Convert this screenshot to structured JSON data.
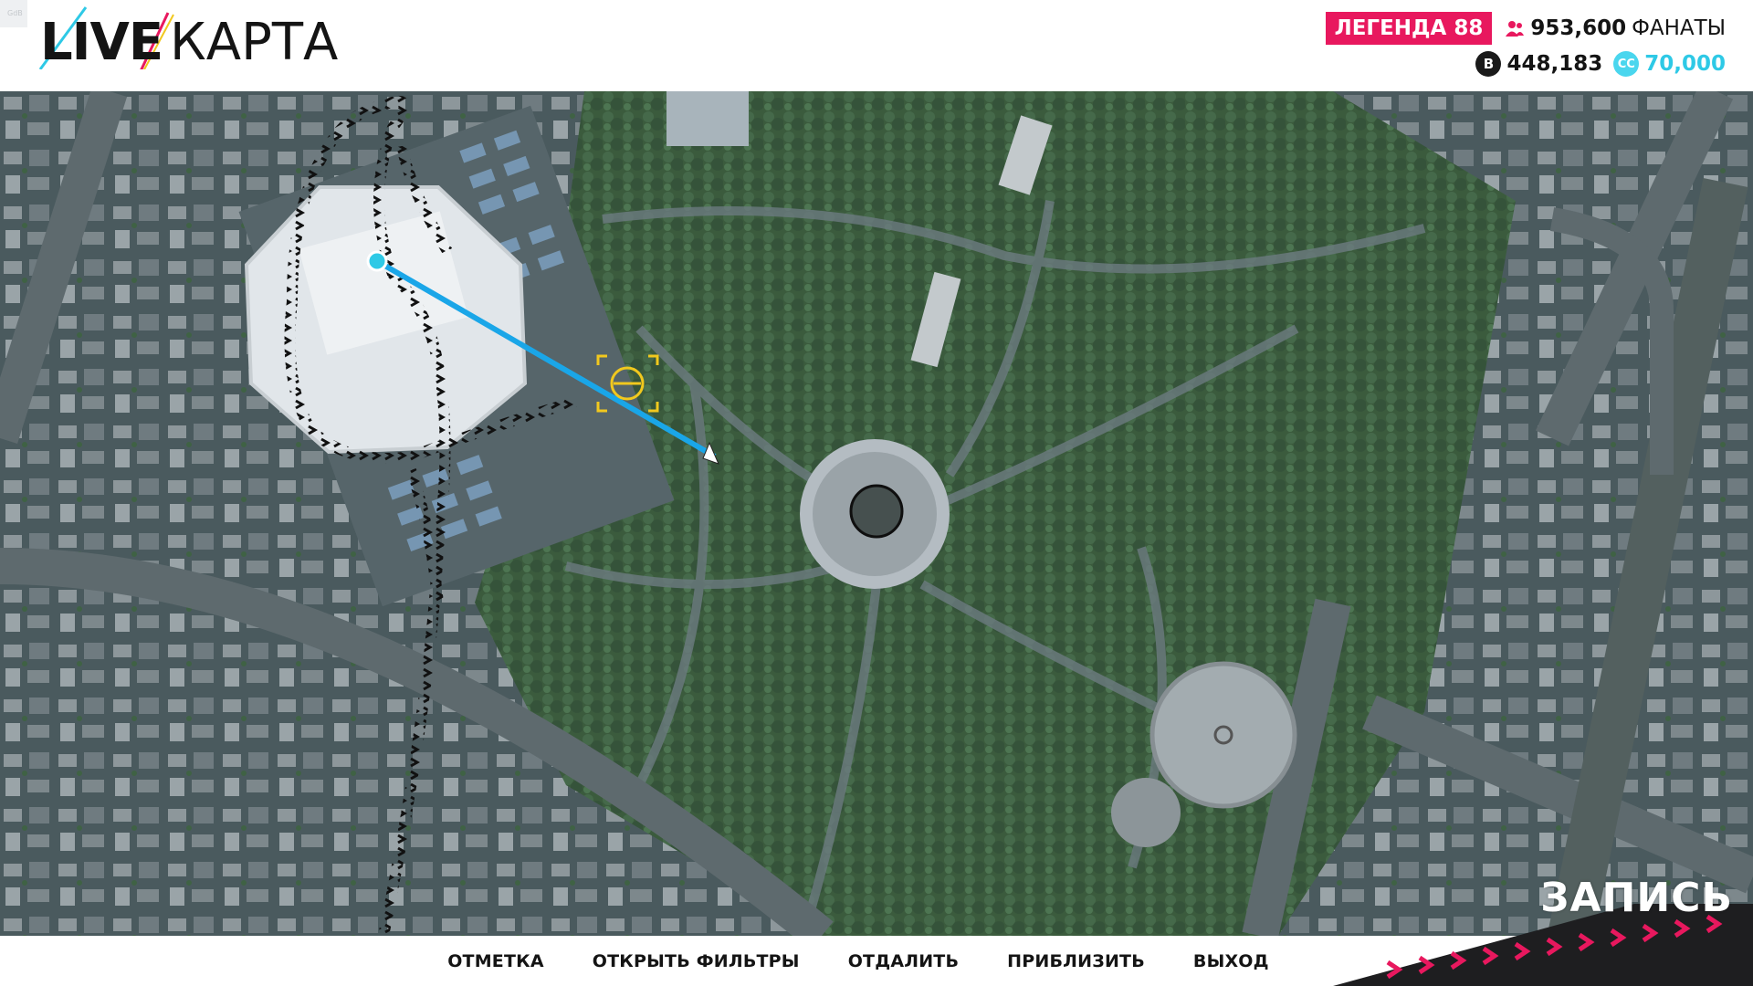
{
  "corner_tag": "GdB",
  "logo": {
    "part1": "LIVE",
    "part2": "КАРТА"
  },
  "stats": {
    "legend_badge": "ЛЕГЕНДА 88",
    "fans_value": "953,600",
    "fans_label": "ФАНАТЫ",
    "credits": "448,183",
    "cc_value": "70,000",
    "cc_icon_text": "CC",
    "credit_icon_text": "B"
  },
  "colors": {
    "accent": "#e8185e",
    "route": "#1aa6e8",
    "cc": "#2ec9e6",
    "target": "#f1c81e"
  },
  "icons": [
    "fans-icon",
    "credit-coin-icon",
    "cc-coin-icon",
    "target-reticle-icon",
    "player-arrow-icon",
    "destination-marker-icon"
  ],
  "menu": [
    {
      "label": "ОТМЕТКА"
    },
    {
      "label": "ОТКРЫТЬ ФИЛЬТРЫ"
    },
    {
      "label": "ОТДАЛИТЬ"
    },
    {
      "label": "ПРИБЛИЗИТЬ"
    },
    {
      "label": "ВЫХОД"
    }
  ],
  "recording": "ЗАПИСЬ"
}
